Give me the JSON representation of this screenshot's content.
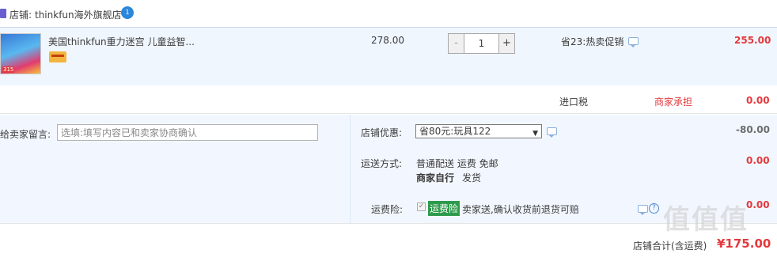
{
  "store": {
    "label": "店铺:",
    "name": "thinkfun海外旗舰店",
    "icon": "shop-icon",
    "chat_icon": "wangwang-icon"
  },
  "item": {
    "title": "美国thinkfun重力迷宫 儿童益智...",
    "thumbnail_tag": "315",
    "price": "278.00",
    "quantity": "1",
    "qty_minus": "-",
    "qty_plus": "+",
    "promotion": "省23:热卖促销",
    "subtotal": "255.00"
  },
  "tax": {
    "label": "进口税",
    "bearer": "商家承担",
    "value": "0.00"
  },
  "message": {
    "label": "给卖家留言:",
    "placeholder": "选填:填写内容已和卖家协商确认"
  },
  "coupon": {
    "label": "店铺优惠:",
    "selected": "省80元:玩具122",
    "value": "-80.00"
  },
  "shipping": {
    "label": "运送方式:",
    "line1": "普通配送 运费 免邮",
    "line2_bold": "商家自行",
    "line2_rest": "发货",
    "value": "0.00"
  },
  "insurance": {
    "label": "运费险:",
    "tag": "运费险",
    "desc": "卖家送,确认收货前退货可赔",
    "value": "0.00",
    "checked": true
  },
  "total": {
    "label": "店铺合计(含运费)",
    "value": "¥175.00"
  },
  "watermark": "值值值",
  "colors": {
    "accent_red": "#e4393c",
    "row_blue": "#f0f6fe",
    "border_blue": "#c4d9f4",
    "insurance_green": "#2e9a4b"
  }
}
